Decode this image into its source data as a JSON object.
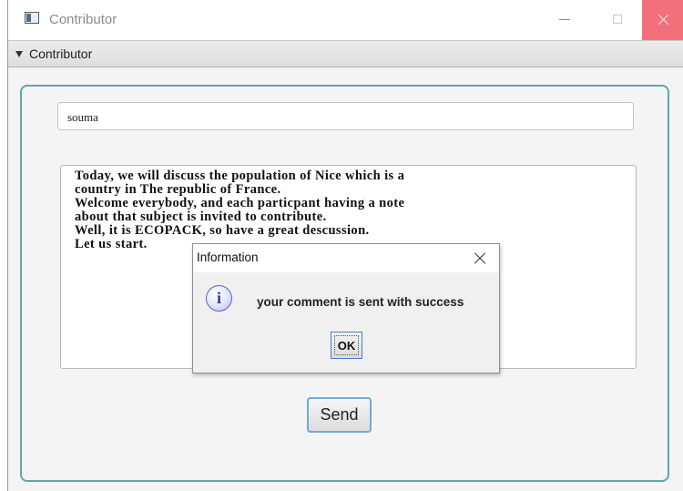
{
  "window": {
    "title": "Contributor",
    "icon": "app-window-icon"
  },
  "pane": {
    "title": "Contributor",
    "expanded": true
  },
  "form": {
    "name_value": "souma",
    "text_lines": [
      "Today, we will discuss the population of Nice which is a",
      "country in The republic of  France.",
      "Welcome everybody, and each particpant having a note",
      "about that subject is invited to contribute.",
      "Well, it is ECOPACK, so have a great descussion.",
      "Let us start."
    ],
    "send_label": "Send"
  },
  "dialog": {
    "title": "Information",
    "icon": "information-icon",
    "icon_glyph": "i",
    "message": "your comment is sent with success",
    "ok_label": "OK"
  },
  "colors": {
    "frame_border": "#5fa8a8",
    "send_focus": "#6aaed6",
    "close_button": "#f1707a",
    "ok_border": "#4a7bd0"
  }
}
